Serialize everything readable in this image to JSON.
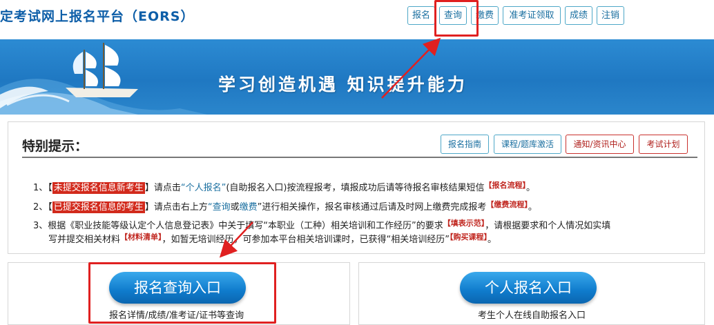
{
  "header": {
    "title": "定考试网上报名平台（EORS）",
    "nav": [
      {
        "label": "报名"
      },
      {
        "label": "查询"
      },
      {
        "label": "缴费"
      },
      {
        "label": "准考证领取"
      },
      {
        "label": "成绩"
      },
      {
        "label": "注销"
      }
    ]
  },
  "banner": {
    "slogan": "学习创造机遇  知识提升能力"
  },
  "notice": {
    "title": "特别提示：",
    "buttons": [
      {
        "label": "报名指南"
      },
      {
        "label": "课程/题库激活"
      },
      {
        "label": "通知/资讯中心"
      },
      {
        "label": "考试计划"
      }
    ],
    "item1": {
      "num": "1、",
      "bracket_open": "【",
      "highlight": "未提交报名信息新考生",
      "bracket_close": "】",
      "t1": "请点击",
      "link": "“个人报名”",
      "t2": "(自助报名入口)按流程报考，填报成功后请等待报名审核结果短信",
      "tag": "【报名流程】",
      "end": "。"
    },
    "item2": {
      "num": "2、",
      "bracket_open": "【",
      "highlight": "已提交报名信息的考生",
      "bracket_close": "】",
      "t1": "请点击右上方",
      "link1": "“查询",
      "or": "或",
      "link2": "缴费",
      "t2": "”进行相关操作，报名审核通过后请及时网上缴费完成报考",
      "tag": "【缴费流程】",
      "end": "。"
    },
    "item3": {
      "num": "3、",
      "t1": "根据《职业技能等级认定个人信息登记表》中关于填写“本职业（工种）相关培训和工作经历”的要求",
      "tag1": "【填表示范】",
      "t2": "，请根据要求和个人情况如实填",
      "t3": "写并提交相关材料",
      "tag2": "【材料清单】",
      "t4": "，如暂无培训经历，可参加本平台相关培训课时，已获得“相关培训经历”",
      "tag3": "【购买课程】",
      "end": "。"
    }
  },
  "entries": {
    "query": {
      "button": "报名查询入口",
      "desc": "报名详情/成绩/准考证/证书等查询"
    },
    "register": {
      "button": "个人报名入口",
      "desc": "考生个人在线自助报名入口"
    }
  },
  "colors": {
    "accent_blue": "#1a6fa0",
    "highlight_red": "#d22a1c",
    "annotation_red": "#e02020"
  }
}
